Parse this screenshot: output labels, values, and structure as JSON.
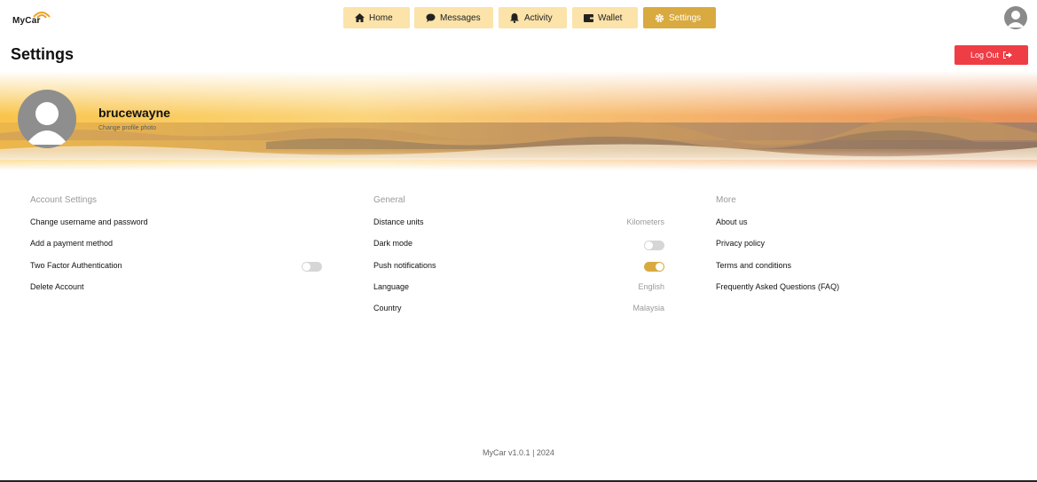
{
  "app": {
    "logo_text": "MyCar"
  },
  "nav": {
    "items": [
      {
        "label": "Home",
        "icon": "home-icon"
      },
      {
        "label": "Messages",
        "icon": "chat-bubble-icon"
      },
      {
        "label": "Activity",
        "icon": "bell-icon"
      },
      {
        "label": "Wallet",
        "icon": "wallet-icon"
      },
      {
        "label": "Settings",
        "icon": "gear-icon",
        "active": true
      }
    ]
  },
  "header": {
    "title": "Settings",
    "logout_label": "Log Out",
    "logout_icon": "sign-out-icon"
  },
  "profile": {
    "username": "brucewayne",
    "change_photo": "Change profile photo"
  },
  "account": {
    "heading": "Account Settings",
    "items": [
      {
        "label": "Change username and password"
      },
      {
        "label": "Add a payment method"
      },
      {
        "label": "Two Factor Authentication",
        "toggle": false
      },
      {
        "label": "Delete Account"
      }
    ]
  },
  "general": {
    "heading": "General",
    "items": [
      {
        "label": "Distance units",
        "value": "Kilometers"
      },
      {
        "label": "Dark mode",
        "toggle": false
      },
      {
        "label": "Push notifications",
        "toggle": true
      },
      {
        "label": "Language",
        "value": "English"
      },
      {
        "label": "Country",
        "value": "Malaysia"
      }
    ]
  },
  "more": {
    "heading": "More",
    "items": [
      {
        "label": "About us"
      },
      {
        "label": "Privacy policy"
      },
      {
        "label": "Terms and conditions"
      },
      {
        "label": "Frequently Asked Questions (FAQ)"
      }
    ]
  },
  "footer": {
    "text": "MyCar v1.0.1 | 2024"
  },
  "colors": {
    "accent": "#d9aa3f",
    "nav_bg": "#fbe3a9",
    "logout": "#ef3d45"
  }
}
